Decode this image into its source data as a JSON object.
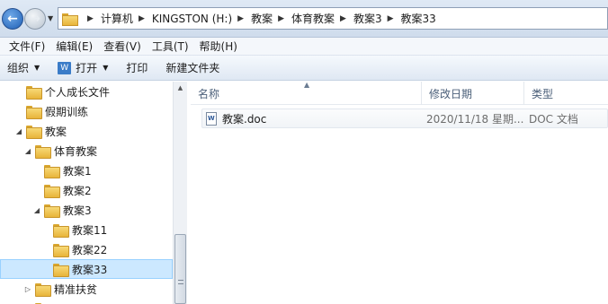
{
  "address_bar": {
    "breadcrumbs": [
      "计算机",
      "KINGSTON (H:)",
      "教案",
      "体育教案",
      "教案3",
      "教案33"
    ]
  },
  "menu": [
    "文件(F)",
    "编辑(E)",
    "查看(V)",
    "工具(T)",
    "帮助(H)"
  ],
  "toolbar": {
    "organize": "组织",
    "open": "打开",
    "print": "打印",
    "new_folder": "新建文件夹"
  },
  "nav_tree": [
    {
      "label": "个人成长文件",
      "expanded": null
    },
    {
      "label": "假期训练",
      "expanded": null
    },
    {
      "label": "教案",
      "expanded": true
    },
    {
      "label": "体育教案",
      "expanded": true
    },
    {
      "label": "教案1",
      "expanded": null
    },
    {
      "label": "教案2",
      "expanded": null
    },
    {
      "label": "教案3",
      "expanded": true
    },
    {
      "label": "教案11",
      "expanded": null
    },
    {
      "label": "教案22",
      "expanded": null
    },
    {
      "label": "教案33",
      "expanded": null,
      "selected": true
    },
    {
      "label": "精准扶贫",
      "expanded": false
    },
    {
      "label": "",
      "expanded": null
    }
  ],
  "columns": {
    "name": "名称",
    "modified": "修改日期",
    "type": "类型"
  },
  "files": [
    {
      "name": "教案.doc",
      "modified": "2020/11/18 星期...",
      "type": "DOC 文档",
      "icon": "word-doc-icon"
    }
  ],
  "colors": {
    "selection": "#cce8ff",
    "header_text": "#4c607a",
    "folder": "#f0c850"
  }
}
